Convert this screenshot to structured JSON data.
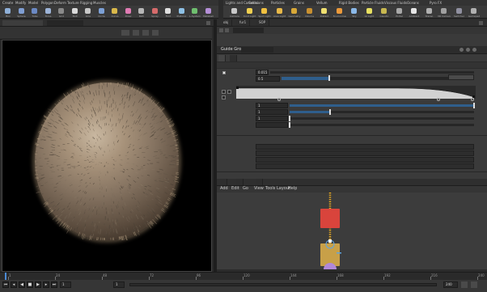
{
  "shelf_left": {
    "tabs": [
      "Create",
      "Modify",
      "Model",
      "Polygon",
      "Deform",
      "Texture",
      "Rigging",
      "Muscles"
    ],
    "tools": [
      {
        "icon": "box-icon",
        "color": "#8fb0d9",
        "label": "Box"
      },
      {
        "icon": "sphere-icon",
        "color": "#7f9ed3",
        "label": "Sphere"
      },
      {
        "icon": "tube-icon",
        "color": "#6b89c4",
        "label": "Tube"
      },
      {
        "icon": "torus-icon",
        "color": "#9db4d8",
        "label": "Torus"
      },
      {
        "icon": "grid-icon",
        "color": "#8a8a8a",
        "label": "Grid"
      },
      {
        "icon": "null-icon",
        "color": "#d9d9d9",
        "label": "Null"
      },
      {
        "icon": "line-icon",
        "color": "#c8c8c8",
        "label": "Line"
      },
      {
        "icon": "circle-icon",
        "color": "#7ca0d6",
        "label": "Circle"
      },
      {
        "icon": "curve-icon",
        "color": "#d9b84a",
        "label": "Curve"
      },
      {
        "icon": "draw-curve-icon",
        "color": "#e07bb3",
        "label": "Draw"
      },
      {
        "icon": "path-icon",
        "color": "#b7b7b7",
        "label": "Path"
      },
      {
        "icon": "spray-paint-icon",
        "color": "#d66b6b",
        "label": "Spray"
      },
      {
        "icon": "font-icon",
        "color": "#e0e0e0",
        "label": "Font"
      },
      {
        "icon": "platonic-icon",
        "color": "#8ec1e6",
        "label": "Platonic"
      },
      {
        "icon": "l-system-icon",
        "color": "#6fbf6f",
        "label": "L-System"
      },
      {
        "icon": "metaball-icon",
        "color": "#b58fd8",
        "label": "Metaball"
      }
    ]
  },
  "shelf_right": {
    "tabs": [
      "Lights and Cameras",
      "Collisions",
      "Particles",
      "Grains",
      "Vellum",
      "Rigid Bodies",
      "Particle Fluids",
      "Viscous Fluids",
      "Oceans",
      "Pyro FX"
    ],
    "tools": [
      {
        "icon": "camera-icon",
        "color": "#c9c9c9",
        "label": "Camera"
      },
      {
        "icon": "point-light-icon",
        "color": "#f0d050",
        "label": "Point Light"
      },
      {
        "icon": "spot-light-icon",
        "color": "#f0c040",
        "label": "Spot Light"
      },
      {
        "icon": "area-light-icon",
        "color": "#e8b848",
        "label": "Area Light"
      },
      {
        "icon": "geometry-light-icon",
        "color": "#d8a838",
        "label": "Geometry"
      },
      {
        "icon": "volume-light-icon",
        "color": "#c89030",
        "label": "Volume"
      },
      {
        "icon": "distant-light-icon",
        "color": "#f0e070",
        "label": "Distant"
      },
      {
        "icon": "env-light-icon",
        "color": "#ec9a3a",
        "label": "Environment"
      },
      {
        "icon": "sky-light-icon",
        "color": "#8ab8e8",
        "label": "Sky"
      },
      {
        "icon": "gi-light-icon",
        "color": "#e8e060",
        "label": "GI Light"
      },
      {
        "icon": "caustic-light-icon",
        "color": "#c8b850",
        "label": "Caustic"
      },
      {
        "icon": "portal-light-icon",
        "color": "#a8a8a8",
        "label": "Portal"
      },
      {
        "icon": "ambient-light-icon",
        "color": "#e6e6e6",
        "label": "Ambient"
      },
      {
        "icon": "stereo-camera-icon",
        "color": "#b0b0b0",
        "label": "Stereo"
      },
      {
        "icon": "vr-camera-icon",
        "color": "#a0a0a0",
        "label": "VR Camera"
      },
      {
        "icon": "switcher-icon",
        "color": "#9090a0",
        "label": "Switcher"
      },
      {
        "icon": "gamepad-camera-icon",
        "color": "#b0b0b0",
        "label": "Gamepad"
      }
    ]
  },
  "viewport": {
    "toolbar_items": [
      "",
      "",
      "",
      ""
    ],
    "overlay_line1": "",
    "overlay_line2": "",
    "overlay_line3": "",
    "caption": ""
  },
  "param_editor": {
    "path_tabs": [
      "obj",
      "fur1",
      "SOP"
    ],
    "node_type": "Guide Groom",
    "node_name": "",
    "tabs": [
      "",
      ""
    ],
    "section1": "",
    "row1_label": "",
    "row1_value": "0.015",
    "row2_label": "",
    "row2_value": "0.5",
    "row2_fill_pct": 28,
    "dropdown_value": "",
    "ramp_label": "",
    "fields": [
      {
        "label": "",
        "value": "1",
        "fill_pct": 100
      },
      {
        "label": "",
        "value": "1",
        "fill_pct": 22
      },
      {
        "label": "",
        "value": "1",
        "fill_pct": 0
      },
      {
        "label": "",
        "value": "",
        "fill_pct": 0
      }
    ],
    "section2": "",
    "rows2": [
      {
        "label": ""
      },
      {
        "label": ""
      },
      {
        "label": ""
      },
      {
        "label": ""
      }
    ],
    "section3": ""
  },
  "network": {
    "path_tabs": [
      "",
      "",
      ""
    ],
    "menu": [
      "Add",
      "Edit",
      "Go",
      "View",
      "Tools",
      "Layout",
      "Help"
    ],
    "colors": {
      "guide_node": "#d9443c",
      "sim_node": "#c8a048",
      "output_node": "#b088d8",
      "wire": "#f2b01e"
    }
  },
  "timeline": {
    "frame": "1",
    "start": "1",
    "end": "240",
    "ticks": [
      "1",
      "24",
      "48",
      "72",
      "96",
      "120",
      "144",
      "168",
      "192",
      "216",
      "240"
    ],
    "controls": [
      "first-frame-icon",
      "prev-frame-icon",
      "play-back-icon",
      "stop-icon",
      "play-icon",
      "next-frame-icon",
      "last-frame-icon"
    ]
  }
}
